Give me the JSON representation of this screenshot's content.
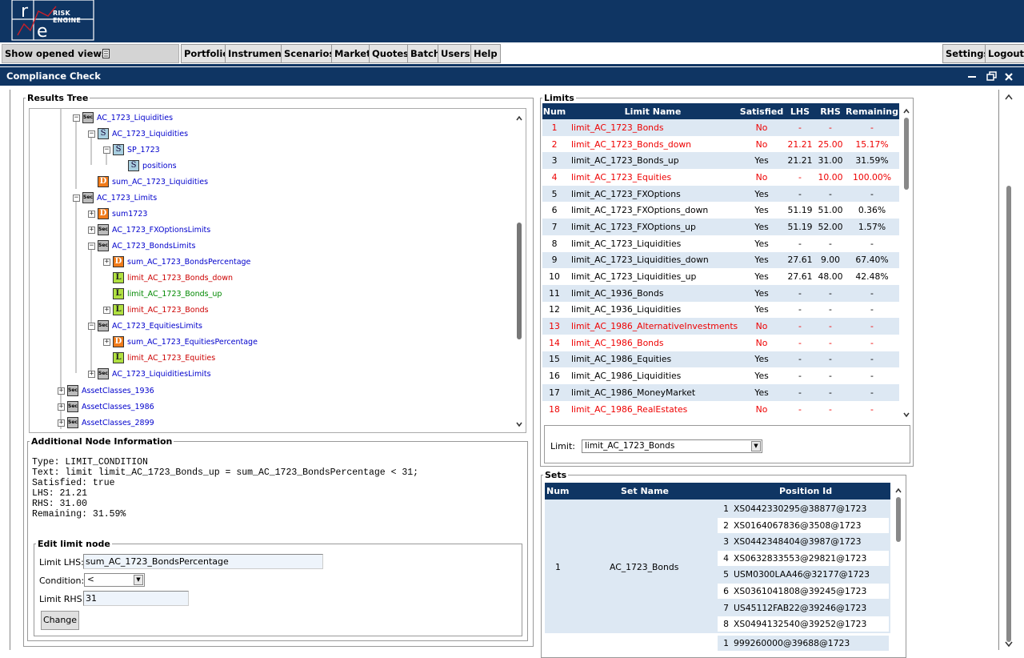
{
  "app": {
    "logo_text": "RISK ENGINE"
  },
  "nav": {
    "show_opened_views": "Show opened views",
    "portfolio": "Portfolio",
    "instrument": "Instrument",
    "scenarios": "Scenarios",
    "market": "Market",
    "quotes": "Quotes",
    "batch": "Batch",
    "users": "Users",
    "help": "Help",
    "settings": "Settings",
    "logout": "Logout"
  },
  "window": {
    "title": "Compliance Check"
  },
  "tree": {
    "legend": "Results Tree",
    "nodes": [
      {
        "label": "AC_1723_Liquidities",
        "icon": "Sec",
        "color": "blue",
        "expander": "-"
      },
      {
        "label": "AC_1723_Liquidities",
        "icon": "S",
        "color": "blue",
        "expander": "-"
      },
      {
        "label": "SP_1723",
        "icon": "S",
        "color": "blue",
        "expander": "-"
      },
      {
        "label": "positions",
        "icon": "S",
        "color": "blue",
        "expander": ""
      },
      {
        "label": "sum_AC_1723_Liquidities",
        "icon": "D",
        "color": "blue",
        "expander": ""
      },
      {
        "label": "AC_1723_Limits",
        "icon": "Sec",
        "color": "blue",
        "expander": "-"
      },
      {
        "label": "sum1723",
        "icon": "D",
        "color": "blue",
        "expander": "+"
      },
      {
        "label": "AC_1723_FXOptionsLimits",
        "icon": "Sec",
        "color": "blue",
        "expander": "+"
      },
      {
        "label": "AC_1723_BondsLimits",
        "icon": "Sec",
        "color": "blue",
        "expander": "-"
      },
      {
        "label": "sum_AC_1723_BondsPercentage",
        "icon": "D",
        "color": "blue",
        "expander": "+"
      },
      {
        "label": "limit_AC_1723_Bonds_down",
        "icon": "L",
        "color": "red",
        "expander": ""
      },
      {
        "label": "limit_AC_1723_Bonds_up",
        "icon": "L",
        "color": "green",
        "expander": ""
      },
      {
        "label": "limit_AC_1723_Bonds",
        "icon": "L",
        "color": "red",
        "expander": "+"
      },
      {
        "label": "AC_1723_EquitiesLimits",
        "icon": "Sec",
        "color": "blue",
        "expander": "-"
      },
      {
        "label": "sum_AC_1723_EquitiesPercentage",
        "icon": "D",
        "color": "blue",
        "expander": "+"
      },
      {
        "label": "limit_AC_1723_Equities",
        "icon": "L",
        "color": "red",
        "expander": ""
      },
      {
        "label": "AC_1723_LiquiditiesLimits",
        "icon": "Sec",
        "color": "blue",
        "expander": "+"
      },
      {
        "label": "AssetClasses_1936",
        "icon": "Sec",
        "color": "blue",
        "expander": "+"
      },
      {
        "label": "AssetClasses_1986",
        "icon": "Sec",
        "color": "blue",
        "expander": "+"
      },
      {
        "label": "AssetClasses_2899",
        "icon": "Sec",
        "color": "blue",
        "expander": "+"
      }
    ]
  },
  "info": {
    "legend": "Additional Node Information",
    "lines": [
      "Type: LIMIT_CONDITION",
      "Text: limit limit_AC_1723_Bonds_up = sum_AC_1723_BondsPercentage < 31;",
      "Satisfied: true",
      "LHS: 21.21",
      "RHS: 31.00",
      "Remaining: 31.59%"
    ]
  },
  "edit": {
    "legend": "Edit limit node",
    "lhs_label": "Limit LHS:",
    "lhs_value": "sum_AC_1723_BondsPercentage",
    "cond_label": "Condition:",
    "cond_value": "<",
    "rhs_label": "Limit RHS:",
    "rhs_value": "31",
    "change": "Change"
  },
  "limits": {
    "legend": "Limits",
    "headers": [
      "Num",
      "Limit Name",
      "Satisfied",
      "LHS",
      "RHS",
      "Remaining"
    ],
    "rows": [
      [
        "1",
        "limit_AC_1723_Bonds",
        "No",
        "-",
        "-",
        "-"
      ],
      [
        "2",
        "limit_AC_1723_Bonds_down",
        "No",
        "21.21",
        "25.00",
        "15.17%"
      ],
      [
        "3",
        "limit_AC_1723_Bonds_up",
        "Yes",
        "21.21",
        "31.00",
        "31.59%"
      ],
      [
        "4",
        "limit_AC_1723_Equities",
        "No",
        "-",
        "10.00",
        "100.00%"
      ],
      [
        "5",
        "limit_AC_1723_FXOptions",
        "Yes",
        "-",
        "-",
        "-"
      ],
      [
        "6",
        "limit_AC_1723_FXOptions_down",
        "Yes",
        "51.19",
        "51.00",
        "0.36%"
      ],
      [
        "7",
        "limit_AC_1723_FXOptions_up",
        "Yes",
        "51.19",
        "52.00",
        "1.57%"
      ],
      [
        "8",
        "limit_AC_1723_Liquidities",
        "Yes",
        "-",
        "-",
        "-"
      ],
      [
        "9",
        "limit_AC_1723_Liquidities_down",
        "Yes",
        "27.61",
        "9.00",
        "67.40%"
      ],
      [
        "10",
        "limit_AC_1723_Liquidities_up",
        "Yes",
        "27.61",
        "48.00",
        "42.48%"
      ],
      [
        "11",
        "limit_AC_1936_Bonds",
        "Yes",
        "-",
        "-",
        "-"
      ],
      [
        "12",
        "limit_AC_1936_Liquidities",
        "Yes",
        "-",
        "-",
        "-"
      ],
      [
        "13",
        "limit_AC_1986_AlternativeInvestments",
        "No",
        "-",
        "-",
        "-"
      ],
      [
        "14",
        "limit_AC_1986_Bonds",
        "No",
        "-",
        "-",
        "-"
      ],
      [
        "15",
        "limit_AC_1986_Equities",
        "Yes",
        "-",
        "-",
        "-"
      ],
      [
        "16",
        "limit_AC_1986_Liquidities",
        "Yes",
        "-",
        "-",
        "-"
      ],
      [
        "17",
        "limit_AC_1986_MoneyMarket",
        "Yes",
        "-",
        "-",
        "-"
      ],
      [
        "18",
        "limit_AC_1986_RealEstates",
        "No",
        "-",
        "-",
        "-"
      ]
    ],
    "select_label": "Limit:",
    "select_value": "limit_AC_1723_Bonds"
  },
  "sets": {
    "legend": "Sets",
    "headers": [
      "Num",
      "Set Name",
      "Position Id"
    ],
    "set1": {
      "num": "1",
      "name": "AC_1723_Bonds",
      "positions": [
        [
          "1",
          "XS0442330295@38877@1723"
        ],
        [
          "2",
          "XS0164067836@3508@1723"
        ],
        [
          "3",
          "XS0442348404@3987@1723"
        ],
        [
          "4",
          "XS0632833553@29821@1723"
        ],
        [
          "5",
          "USM0300LAA46@32177@1723"
        ],
        [
          "6",
          "XS0361041808@39245@1723"
        ],
        [
          "7",
          "US45112FAB22@39246@1723"
        ],
        [
          "8",
          "XS0494132540@39252@1723"
        ]
      ]
    },
    "set2_first": [
      "1",
      "999260000@39688@1723"
    ]
  }
}
